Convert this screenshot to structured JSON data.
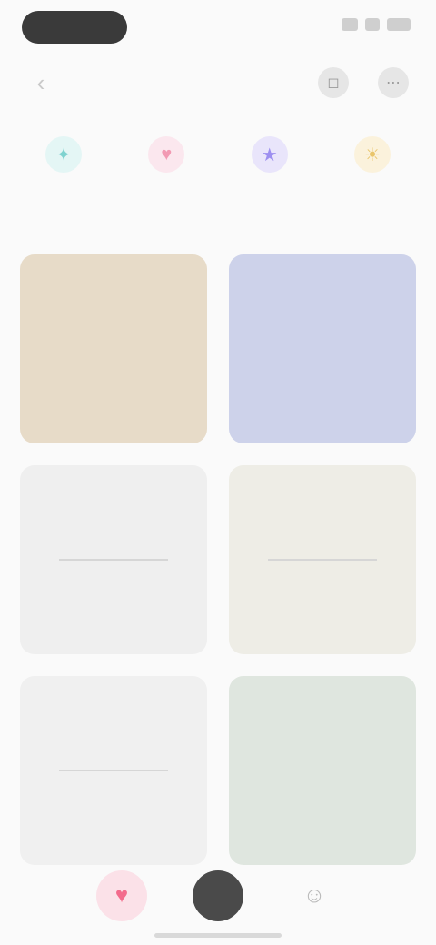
{
  "status_bar": {
    "time": "",
    "right": ""
  },
  "toolbar": {
    "back_glyph": "‹",
    "action1_glyph": "◻",
    "action2_glyph": "⋯"
  },
  "categories": [
    {
      "label": "",
      "icon": "cyan-sparkle-icon",
      "glyph": "✦",
      "color": "#7fd3d0",
      "bg": "#e4f6f5"
    },
    {
      "label": "",
      "icon": "pink-heart-icon",
      "glyph": "♥",
      "color": "#f29ab3",
      "bg": "#fbe7ee"
    },
    {
      "label": "",
      "icon": "purple-star-icon",
      "glyph": "★",
      "color": "#9d8ff0",
      "bg": "#e9e5fb"
    },
    {
      "label": "",
      "icon": "yellow-sun-icon",
      "glyph": "☀",
      "color": "#e9c56b",
      "bg": "#fbf2dc"
    }
  ],
  "cards": [
    {
      "bg": "#e7dbc8",
      "line1": "",
      "line2": "",
      "style": "big"
    },
    {
      "bg": "#cdd2ea",
      "line1": "",
      "line2": "",
      "style": "mid"
    },
    {
      "bg": "#efefef",
      "corner": "",
      "line1": "",
      "line2": "",
      "style": "small"
    },
    {
      "bg": "#eeede6",
      "corner": "",
      "line1": "",
      "line2": "",
      "style": "small"
    },
    {
      "bg": "#f0f0f0",
      "corner": "",
      "line1": "",
      "line2": "",
      "style": "small"
    },
    {
      "bg": "#dfe6df",
      "line1": "",
      "line2": "",
      "style": "mid"
    }
  ],
  "bottom_bar": {
    "left_glyph": "♥",
    "left_color": "#f36b8c",
    "left_bg": "#fbe1e8",
    "center_bg": "#4a4a4a",
    "right_glyph": "☺",
    "right_color": "#b9b9b9"
  }
}
